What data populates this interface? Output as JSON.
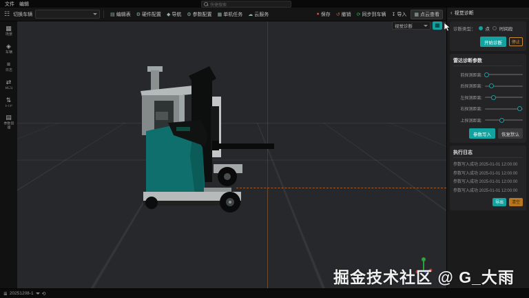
{
  "titlebar": {
    "menu_file": "文件",
    "menu_edit": "编辑",
    "search_placeholder": "快捷搜索"
  },
  "toolbar": {
    "grid_icon": "☷",
    "switch_vehicle_label": "切换车辆",
    "vehicle_select_value": "",
    "buttons": [
      {
        "label": "编辑表",
        "icon": "▤"
      },
      {
        "label": "硬件配置",
        "icon": "⚙"
      },
      {
        "label": "导航",
        "icon": "◆"
      },
      {
        "label": "参数配置",
        "icon": "⚙"
      },
      {
        "label": "单机任务",
        "icon": "▦"
      },
      {
        "label": "云服务",
        "icon": "☁"
      }
    ],
    "right_buttons": [
      {
        "label": "保存",
        "icon": "●",
        "icon_color": "#c4504f"
      },
      {
        "label": "撤销",
        "icon": "↺",
        "icon_color": "#b96a4a"
      },
      {
        "label": "同步到车辆",
        "icon": "⟳",
        "icon_color": "#3fae61"
      },
      {
        "label": "导入",
        "icon": "↧",
        "icon_color": "#bdbdbd"
      },
      {
        "label": "点云查看",
        "icon": "▦",
        "icon_color": "#9fb5b5"
      }
    ]
  },
  "sidebar": {
    "items": [
      {
        "label": "场景",
        "icon": "▦"
      },
      {
        "label": "车辆",
        "icon": "◈"
      },
      {
        "label": "日志",
        "icon": "≡"
      },
      {
        "label": "RCS",
        "icon": "⇄"
      },
      {
        "label": "FTP",
        "icon": "⇅"
      },
      {
        "label": "参数管理",
        "icon": "▤"
      }
    ]
  },
  "viewport": {
    "mode_select_value": "视觉诊断",
    "grid_button_icon": "▦",
    "watermark": "掘金技术社区 @ G_大雨"
  },
  "right_panel": {
    "back_icon": "‹",
    "title": "视觉诊断",
    "diagnosis": {
      "type_label": "诊断类型：",
      "option_point": "点",
      "option_period": "时间段",
      "start_button": "开始诊断",
      "stop_button": "停止"
    },
    "radar": {
      "title": "雷达诊断参数",
      "sliders": [
        {
          "label": "前探测距离:",
          "value_pct": 4
        },
        {
          "label": "后探测距离:",
          "value_pct": 17
        },
        {
          "label": "左探测距离:",
          "value_pct": 21
        },
        {
          "label": "右探测距离:",
          "value_pct": 90
        },
        {
          "label": "上探测距离:",
          "value_pct": 44
        }
      ],
      "write_button": "参数写入",
      "reset_button": "恢复默认"
    },
    "log": {
      "title": "执行日志",
      "entries": [
        "参数写入成功 2025-01-01 12:00:00",
        "参数写入成功 2025-01-01 12:00:00",
        "参数写入成功 2025-01-01 12:00:00",
        "参数写入成功 2025-01-01 12:00:00"
      ],
      "export_button": "导出",
      "clear_button": "清空"
    }
  },
  "statusbar": {
    "menu_icon": "≣",
    "project": "20251208-1",
    "history_icon": "⟲"
  },
  "colors": {
    "accent_teal": "#12a3a0",
    "accent_orange": "#cc8a33",
    "forklift_teal": "#0f6f6c",
    "guide_line_orange": "#b5612c",
    "viewport_bg": "#26282b"
  }
}
